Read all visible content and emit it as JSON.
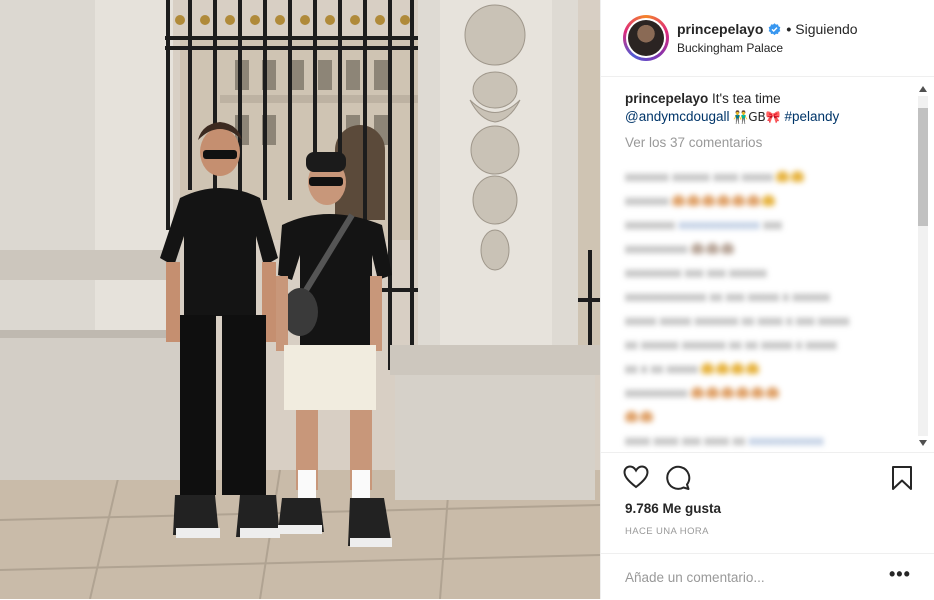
{
  "post": {
    "username": "princepelayo",
    "follow_state": "Siguiendo",
    "location": "Buckingham Palace"
  },
  "caption": {
    "username": "princepelayo",
    "text": "It's tea time",
    "mention": "@andymcdougall",
    "emoji": "👬GB🎀",
    "hashtag": "#pelandy"
  },
  "view_all_comments": "Ver los 37 comentarios",
  "likes": "9.786 Me gusta",
  "timestamp": "HACE UNA HORA",
  "comment_box": {
    "placeholder": "Añade un comentario..."
  },
  "more_options": "•••",
  "icons": {
    "verified": "verified-badge-icon",
    "like": "heart-icon",
    "comment": "comment-bubble-icon",
    "save": "bookmark-icon",
    "more": "ellipsis-icon"
  },
  "colors": {
    "link": "#003569",
    "verified": "#3897f0",
    "muted": "#999999"
  }
}
